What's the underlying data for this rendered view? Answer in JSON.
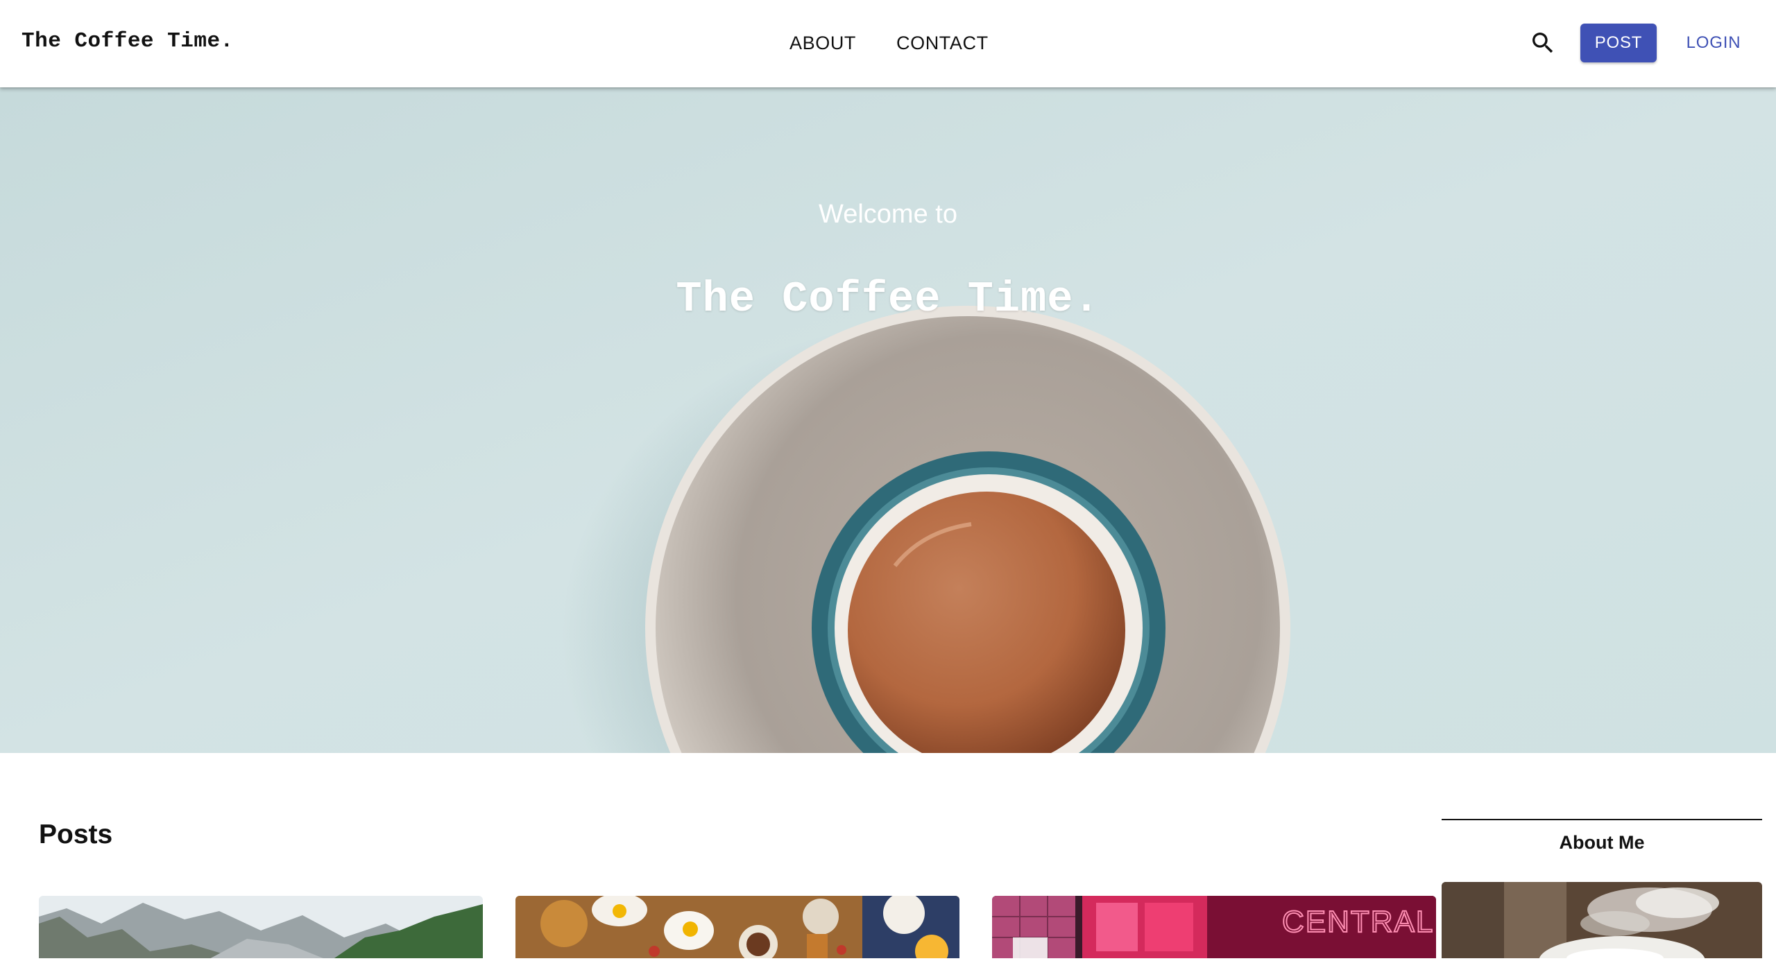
{
  "header": {
    "brand": "The Coffee Time.",
    "nav": {
      "about": "ABOUT",
      "contact": "CONTACT"
    },
    "search_icon": "search-icon",
    "post_label": "POST",
    "login_label": "LOGIN"
  },
  "hero": {
    "subtitle": "Welcome to",
    "title": "The Coffee Time."
  },
  "posts": {
    "heading": "Posts",
    "cards": [
      {
        "image": "mountain-landscape-photo",
        "sign": ""
      },
      {
        "image": "breakfast-table-photo",
        "sign": ""
      },
      {
        "image": "cinema-neon-photo",
        "sign": "CENTRAL CINEMA"
      }
    ]
  },
  "sidebar": {
    "about_heading": "About Me",
    "about_image": "steaming-coffee-cup-photo"
  },
  "colors": {
    "primary": "#3f51b5",
    "hero_background": "#cfe0e1",
    "text": "#111111"
  }
}
